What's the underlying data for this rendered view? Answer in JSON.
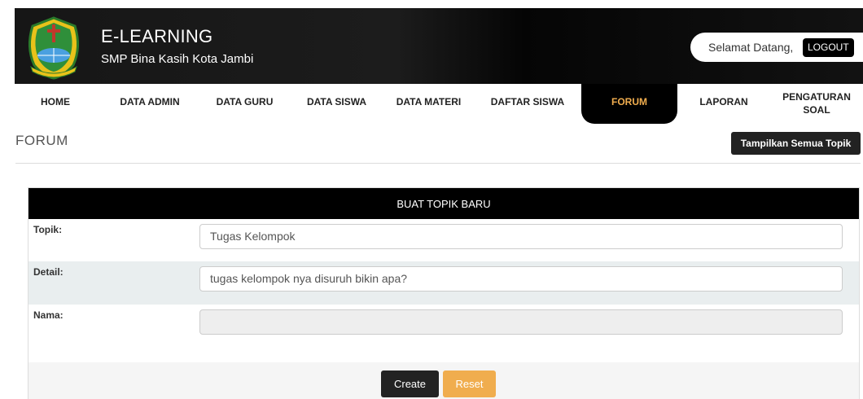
{
  "header": {
    "title": "E-LEARNING",
    "subtitle": "SMP Bina Kasih Kota Jambi",
    "welcome": "Selamat Datang,",
    "logout_label": "LOGOUT"
  },
  "nav": {
    "items": [
      {
        "label": "HOME"
      },
      {
        "label": "DATA ADMIN"
      },
      {
        "label": "DATA GURU"
      },
      {
        "label": "DATA SISWA"
      },
      {
        "label": "DATA MATERI"
      },
      {
        "label": "DAFTAR SISWA"
      },
      {
        "label": "FORUM"
      },
      {
        "label": "LAPORAN"
      },
      {
        "label": "PENGATURAN SOAL"
      }
    ],
    "active": "FORUM"
  },
  "page": {
    "title": "FORUM",
    "show_all_label": "Tampilkan Semua Topik"
  },
  "form": {
    "heading": "BUAT TOPIK BARU",
    "topik_label": "Topik:",
    "topik_value": "Tugas Kelompok",
    "detail_label": "Detail:",
    "detail_value": "tugas kelompok nya disuruh bikin apa?",
    "nama_label": "Nama:",
    "nama_value": "",
    "create_label": "Create",
    "reset_label": "Reset"
  },
  "colors": {
    "accent": "#f0ad4e",
    "header_bg": "#111111",
    "button_dark": "#222222"
  }
}
